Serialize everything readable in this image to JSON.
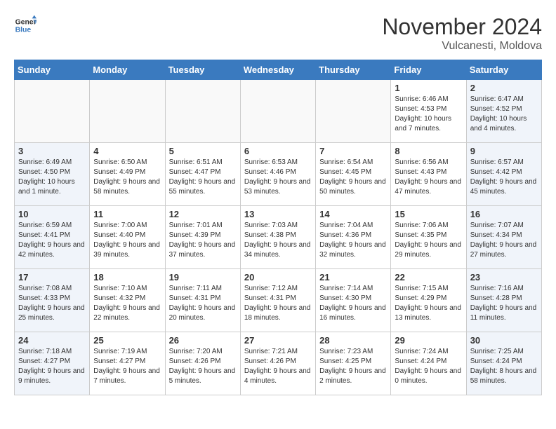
{
  "header": {
    "logo_general": "General",
    "logo_blue": "Blue",
    "month_title": "November 2024",
    "subtitle": "Vulcanesti, Moldova"
  },
  "days_of_week": [
    "Sunday",
    "Monday",
    "Tuesday",
    "Wednesday",
    "Thursday",
    "Friday",
    "Saturday"
  ],
  "weeks": [
    [
      {
        "day": "",
        "info": "",
        "type": "empty"
      },
      {
        "day": "",
        "info": "",
        "type": "empty"
      },
      {
        "day": "",
        "info": "",
        "type": "empty"
      },
      {
        "day": "",
        "info": "",
        "type": "empty"
      },
      {
        "day": "",
        "info": "",
        "type": "empty"
      },
      {
        "day": "1",
        "info": "Sunrise: 6:46 AM\nSunset: 4:53 PM\nDaylight: 10 hours and 7 minutes.",
        "type": "weekday"
      },
      {
        "day": "2",
        "info": "Sunrise: 6:47 AM\nSunset: 4:52 PM\nDaylight: 10 hours and 4 minutes.",
        "type": "weekend"
      }
    ],
    [
      {
        "day": "3",
        "info": "Sunrise: 6:49 AM\nSunset: 4:50 PM\nDaylight: 10 hours and 1 minute.",
        "type": "weekend"
      },
      {
        "day": "4",
        "info": "Sunrise: 6:50 AM\nSunset: 4:49 PM\nDaylight: 9 hours and 58 minutes.",
        "type": "weekday"
      },
      {
        "day": "5",
        "info": "Sunrise: 6:51 AM\nSunset: 4:47 PM\nDaylight: 9 hours and 55 minutes.",
        "type": "weekday"
      },
      {
        "day": "6",
        "info": "Sunrise: 6:53 AM\nSunset: 4:46 PM\nDaylight: 9 hours and 53 minutes.",
        "type": "weekday"
      },
      {
        "day": "7",
        "info": "Sunrise: 6:54 AM\nSunset: 4:45 PM\nDaylight: 9 hours and 50 minutes.",
        "type": "weekday"
      },
      {
        "day": "8",
        "info": "Sunrise: 6:56 AM\nSunset: 4:43 PM\nDaylight: 9 hours and 47 minutes.",
        "type": "weekday"
      },
      {
        "day": "9",
        "info": "Sunrise: 6:57 AM\nSunset: 4:42 PM\nDaylight: 9 hours and 45 minutes.",
        "type": "weekend"
      }
    ],
    [
      {
        "day": "10",
        "info": "Sunrise: 6:59 AM\nSunset: 4:41 PM\nDaylight: 9 hours and 42 minutes.",
        "type": "weekend"
      },
      {
        "day": "11",
        "info": "Sunrise: 7:00 AM\nSunset: 4:40 PM\nDaylight: 9 hours and 39 minutes.",
        "type": "weekday"
      },
      {
        "day": "12",
        "info": "Sunrise: 7:01 AM\nSunset: 4:39 PM\nDaylight: 9 hours and 37 minutes.",
        "type": "weekday"
      },
      {
        "day": "13",
        "info": "Sunrise: 7:03 AM\nSunset: 4:38 PM\nDaylight: 9 hours and 34 minutes.",
        "type": "weekday"
      },
      {
        "day": "14",
        "info": "Sunrise: 7:04 AM\nSunset: 4:36 PM\nDaylight: 9 hours and 32 minutes.",
        "type": "weekday"
      },
      {
        "day": "15",
        "info": "Sunrise: 7:06 AM\nSunset: 4:35 PM\nDaylight: 9 hours and 29 minutes.",
        "type": "weekday"
      },
      {
        "day": "16",
        "info": "Sunrise: 7:07 AM\nSunset: 4:34 PM\nDaylight: 9 hours and 27 minutes.",
        "type": "weekend"
      }
    ],
    [
      {
        "day": "17",
        "info": "Sunrise: 7:08 AM\nSunset: 4:33 PM\nDaylight: 9 hours and 25 minutes.",
        "type": "weekend"
      },
      {
        "day": "18",
        "info": "Sunrise: 7:10 AM\nSunset: 4:32 PM\nDaylight: 9 hours and 22 minutes.",
        "type": "weekday"
      },
      {
        "day": "19",
        "info": "Sunrise: 7:11 AM\nSunset: 4:31 PM\nDaylight: 9 hours and 20 minutes.",
        "type": "weekday"
      },
      {
        "day": "20",
        "info": "Sunrise: 7:12 AM\nSunset: 4:31 PM\nDaylight: 9 hours and 18 minutes.",
        "type": "weekday"
      },
      {
        "day": "21",
        "info": "Sunrise: 7:14 AM\nSunset: 4:30 PM\nDaylight: 9 hours and 16 minutes.",
        "type": "weekday"
      },
      {
        "day": "22",
        "info": "Sunrise: 7:15 AM\nSunset: 4:29 PM\nDaylight: 9 hours and 13 minutes.",
        "type": "weekday"
      },
      {
        "day": "23",
        "info": "Sunrise: 7:16 AM\nSunset: 4:28 PM\nDaylight: 9 hours and 11 minutes.",
        "type": "weekend"
      }
    ],
    [
      {
        "day": "24",
        "info": "Sunrise: 7:18 AM\nSunset: 4:27 PM\nDaylight: 9 hours and 9 minutes.",
        "type": "weekend"
      },
      {
        "day": "25",
        "info": "Sunrise: 7:19 AM\nSunset: 4:27 PM\nDaylight: 9 hours and 7 minutes.",
        "type": "weekday"
      },
      {
        "day": "26",
        "info": "Sunrise: 7:20 AM\nSunset: 4:26 PM\nDaylight: 9 hours and 5 minutes.",
        "type": "weekday"
      },
      {
        "day": "27",
        "info": "Sunrise: 7:21 AM\nSunset: 4:26 PM\nDaylight: 9 hours and 4 minutes.",
        "type": "weekday"
      },
      {
        "day": "28",
        "info": "Sunrise: 7:23 AM\nSunset: 4:25 PM\nDaylight: 9 hours and 2 minutes.",
        "type": "weekday"
      },
      {
        "day": "29",
        "info": "Sunrise: 7:24 AM\nSunset: 4:24 PM\nDaylight: 9 hours and 0 minutes.",
        "type": "weekday"
      },
      {
        "day": "30",
        "info": "Sunrise: 7:25 AM\nSunset: 4:24 PM\nDaylight: 8 hours and 58 minutes.",
        "type": "weekend"
      }
    ]
  ]
}
